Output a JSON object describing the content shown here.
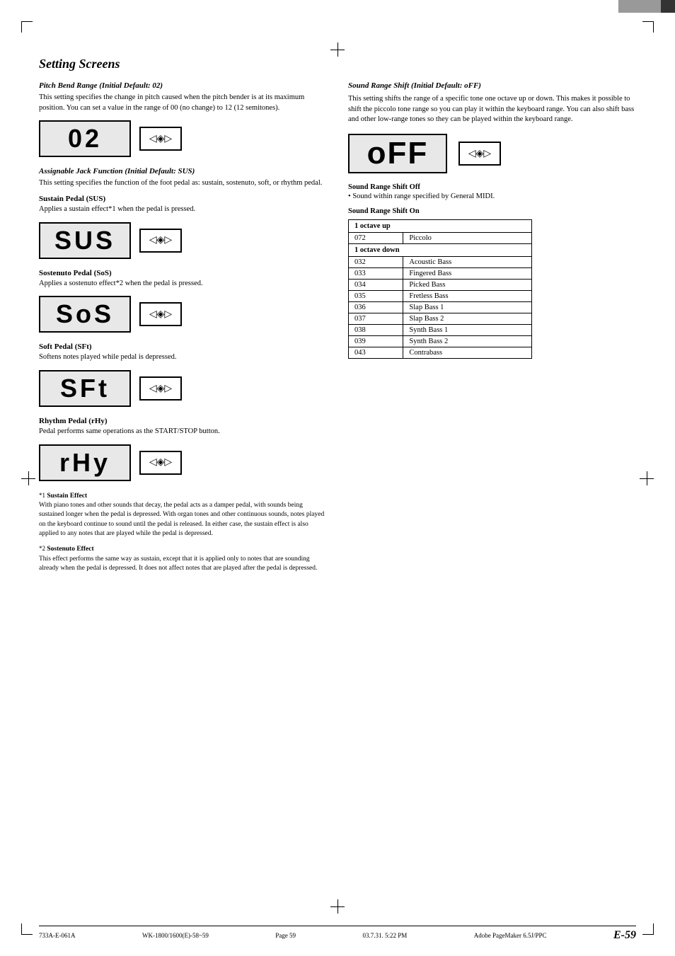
{
  "topbar": {
    "gray_label": "",
    "dark_label": ""
  },
  "page": {
    "title": "Setting Screens",
    "footer_left": "733A-E-061A",
    "footer_center": "WK-1800/1600(E)-58~59",
    "footer_page": "Page 59",
    "footer_date": "03.7.31. 5:22 PM",
    "footer_app": "Adobe PageMaker 6.5J/PPC",
    "page_number": "E-59"
  },
  "left": {
    "pitch_bend": {
      "heading": "Pitch Bend Range (Initial Default: 02)",
      "body": "This setting specifies the change in pitch caused when the pitch bender is at its maximum position. You can set a value in the range of 00 (no change) to 12 (12 semitones).",
      "display": "02",
      "arrow": "◁◈▷"
    },
    "assignable": {
      "heading": "Assignable Jack Function (Initial Default: SUS)",
      "body": "This setting specifies the function of the foot pedal as: sustain, sostenuto, soft, or rhythm pedal."
    },
    "sus": {
      "heading": "Sustain Pedal (SUS)",
      "body": "Applies a sustain effect*1 when the pedal is pressed.",
      "display": "SUS",
      "arrow": "◁◈▷"
    },
    "sos": {
      "heading": "Sostenuto Pedal (SoS)",
      "body": "Applies a sostenuto effect*2 when the pedal is pressed.",
      "display": "SoS",
      "arrow": "◁◈▷"
    },
    "sft": {
      "heading": "Soft Pedal (SFt)",
      "body": "Softens notes played while pedal is depressed.",
      "display": "SFt",
      "arrow": "◁◈▷"
    },
    "rhy": {
      "heading": "Rhythm Pedal (rHy)",
      "body": "Pedal performs same operations as the START/STOP button.",
      "display": "rHy",
      "arrow": "◁◈▷"
    },
    "footnote1_label": "*1",
    "footnote1_title": "Sustain Effect",
    "footnote1_body": "With piano tones and other sounds that decay, the pedal acts as a damper pedal, with sounds being sustained longer when the pedal is depressed. With organ tones and other continuous sounds, notes played on the keyboard continue to sound until the pedal is released. In either case, the sustain effect is also applied to any notes that are played while the pedal is depressed.",
    "footnote2_label": "*2",
    "footnote2_title": "Sostenuto Effect",
    "footnote2_body": "This effect performs the same way as sustain, except that it is applied only to notes that are sounding already when the pedal is depressed. It does not affect notes that are played after the pedal is depressed."
  },
  "right": {
    "heading": "Sound Range Shift (Initial Default: oFF)",
    "body": "This setting shifts the range of a specific tone one octave up or down. This makes it possible to shift the piccolo tone range so you can play it within the keyboard range. You can also shift bass and other low-range tones so they can be played within the keyboard range.",
    "display": "oFF",
    "arrow": "◁◈▷",
    "shift_off_label": "Sound Range Shift Off",
    "shift_off_bullet": "Sound within range specified by General MIDI.",
    "shift_on_label": "Sound Range Shift On",
    "table": {
      "col1": "1 octave up",
      "octave_up_rows": [
        {
          "num": "072",
          "name": "Piccolo"
        }
      ],
      "col2": "1 octave down",
      "octave_down_rows": [
        {
          "num": "032",
          "name": "Acoustic Bass"
        },
        {
          "num": "033",
          "name": "Fingered Bass"
        },
        {
          "num": "034",
          "name": "Picked Bass"
        },
        {
          "num": "035",
          "name": "Fretless Bass"
        },
        {
          "num": "036",
          "name": "Slap Bass 1"
        },
        {
          "num": "037",
          "name": "Slap Bass 2"
        },
        {
          "num": "038",
          "name": "Synth Bass 1"
        },
        {
          "num": "039",
          "name": "Synth Bass 2"
        },
        {
          "num": "043",
          "name": "Contrabass"
        }
      ]
    }
  }
}
